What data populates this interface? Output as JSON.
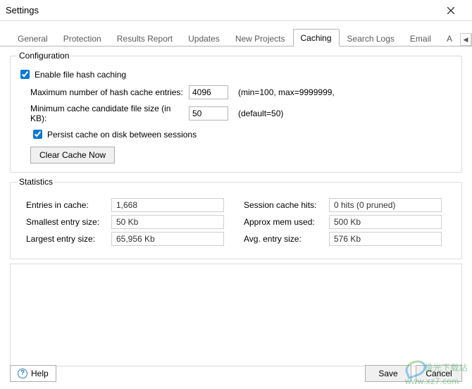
{
  "window": {
    "title": "Settings"
  },
  "tabs": {
    "items": [
      {
        "label": "General"
      },
      {
        "label": "Protection"
      },
      {
        "label": "Results Report"
      },
      {
        "label": "Updates"
      },
      {
        "label": "New Projects"
      },
      {
        "label": "Caching"
      },
      {
        "label": "Search Logs"
      },
      {
        "label": "Email"
      },
      {
        "label": "A"
      }
    ],
    "active_index": 5,
    "scroll_left_glyph": "◀",
    "scroll_right_glyph": "▶"
  },
  "config": {
    "legend": "Configuration",
    "enable_caching_label": "Enable file hash caching",
    "enable_caching_checked": true,
    "max_entries": {
      "label": "Maximum number of hash cache entries:",
      "value": "4096",
      "hint": "(min=100, max=9999999,"
    },
    "min_size": {
      "label": "Minimum cache candidate file size (in KB):",
      "value": "50",
      "hint": "(default=50)"
    },
    "persist_label": "Persist cache on disk between sessions",
    "persist_checked": true,
    "clear_button": "Clear Cache Now"
  },
  "stats": {
    "legend": "Statistics",
    "left": [
      {
        "label": "Entries in cache:",
        "value": "1,668"
      },
      {
        "label": "Smallest entry size:",
        "value": "50 Kb"
      },
      {
        "label": "Largest entry size:",
        "value": "65,956 Kb"
      }
    ],
    "right": [
      {
        "label": "Session cache hits:",
        "value": "0 hits (0 pruned)"
      },
      {
        "label": "Approx mem used:",
        "value": "500 Kb"
      },
      {
        "label": "Avg. entry size:",
        "value": "576 Kb"
      }
    ]
  },
  "footer": {
    "help": "Help",
    "save": "Save",
    "cancel": "Cancel"
  },
  "watermark": {
    "line1": "极光下载站",
    "line2": "www.xz7.com"
  }
}
